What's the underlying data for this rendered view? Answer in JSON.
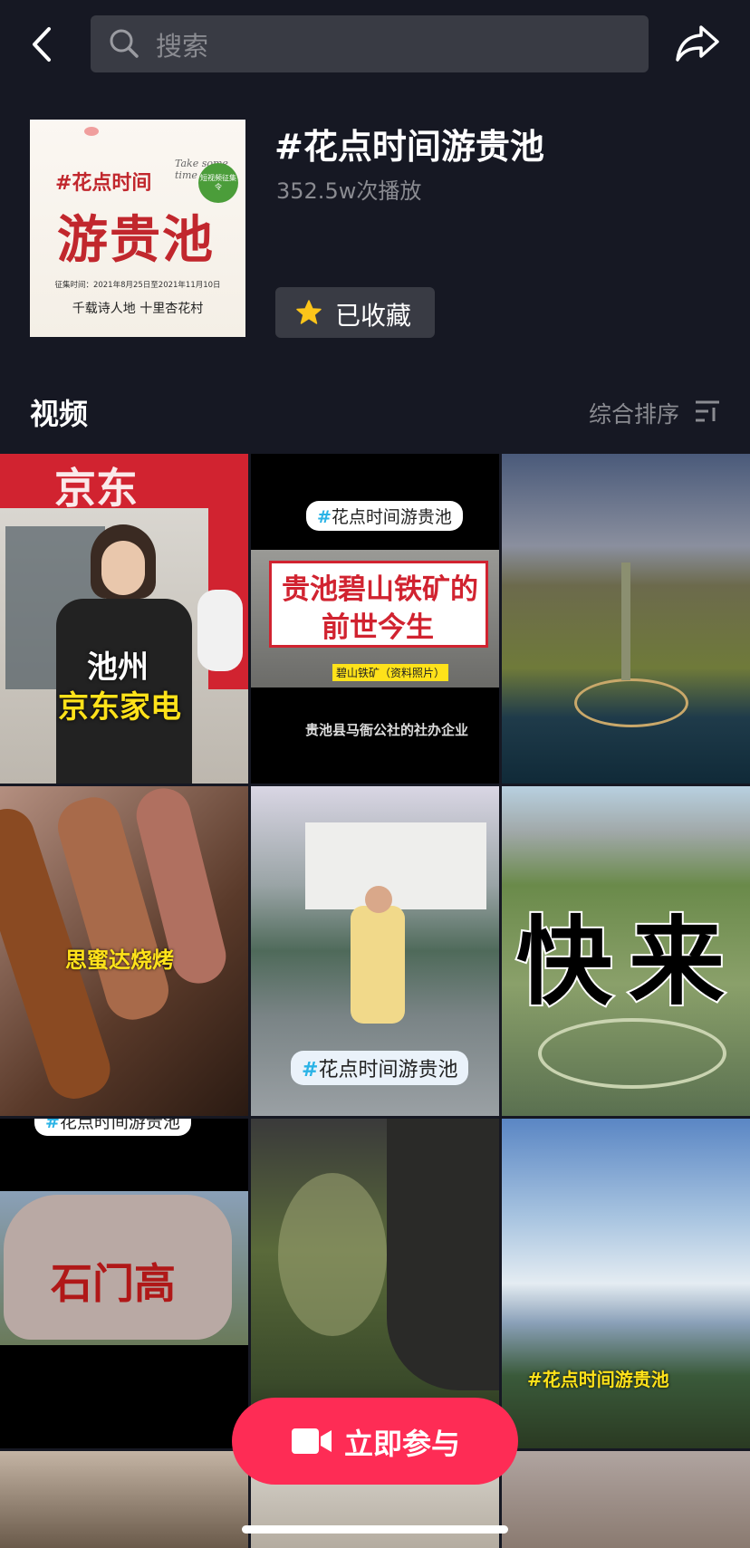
{
  "search": {
    "placeholder": "搜索"
  },
  "topic": {
    "title": "#花点时间游贵池",
    "plays": "352.5w次播放",
    "favorite_label": "已收藏",
    "cover": {
      "line1": "#花点时间",
      "line2": "游贵池",
      "script": "Take some time",
      "badge": "短视频征集令",
      "dates": "征集时间：2021年8月25日至2021年11月10日",
      "slogan": "千载诗人地 十里杏花村"
    }
  },
  "section": {
    "title": "视频",
    "sort_label": "综合排序"
  },
  "videos": [
    {
      "caption1": "池州",
      "caption2": "京东家电",
      "sign": "京东"
    },
    {
      "tag": "#花点时间游贵池",
      "headline1": "贵池碧山铁矿的",
      "headline2": "前世今生",
      "sub": "碧山铁矿（资料照片）",
      "bottom": "贵池县马衙公社的社办企业"
    },
    {},
    {
      "caption": "思蜜达烧烤"
    },
    {
      "tag": "#花点时间游贵池"
    },
    {
      "caption": "快来"
    },
    {
      "tag": "#花点时间游贵池",
      "rock": "石门高"
    },
    {},
    {
      "caption": "#花点时间游贵池"
    }
  ],
  "cta": {
    "label": "立即参与"
  },
  "colors": {
    "background": "#161823",
    "accent": "#fe2c55",
    "control": "#393b44",
    "muted": "#8a8b91"
  }
}
